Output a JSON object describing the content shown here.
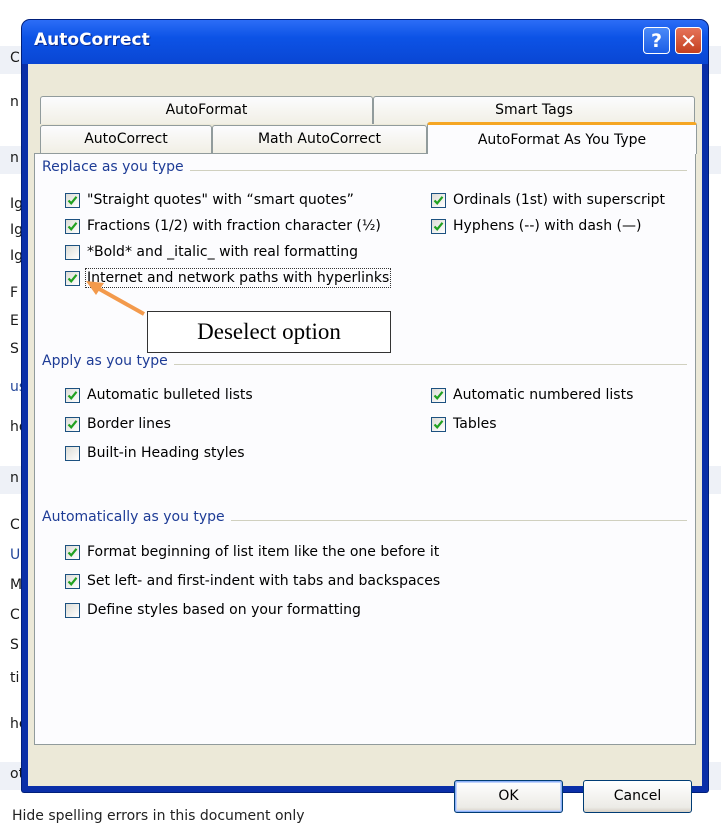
{
  "background": {
    "fragments": [
      "C",
      "n",
      "n",
      "Ig",
      "Ig",
      "Ig",
      "F",
      "E",
      "S",
      "us",
      "hd",
      "n",
      "C",
      "U",
      "M",
      "C",
      "S",
      "ti",
      "he",
      "ot"
    ],
    "bottom_text": "Hide spelling errors in this document only"
  },
  "dialog": {
    "title": "AutoCorrect",
    "help_glyph": "?",
    "close_glyph": "✕",
    "tabs": {
      "autoformat": "AutoFormat",
      "smart_tags": "Smart Tags",
      "autocorrect": "AutoCorrect",
      "math_autocorrect": "Math AutoCorrect",
      "autoformat_as_you_type": "AutoFormat As You Type"
    },
    "groups": {
      "replace": {
        "title": "Replace as you type",
        "options": [
          {
            "label": "\"Straight quotes\" with “smart quotes”",
            "checked": true
          },
          {
            "label": "Ordinals (1st) with superscript",
            "checked": true
          },
          {
            "label": "Fractions (1/2) with fraction character (½)",
            "checked": true
          },
          {
            "label": "Hyphens (--) with dash (—)",
            "checked": true
          },
          {
            "label": "*Bold* and _italic_ with real formatting",
            "checked": false
          },
          {
            "label": "Internet and network paths with hyperlinks",
            "checked": true
          }
        ]
      },
      "apply": {
        "title": "Apply as you type",
        "options": [
          {
            "label": "Automatic bulleted lists",
            "checked": true
          },
          {
            "label": "Automatic numbered lists",
            "checked": true
          },
          {
            "label": "Border lines",
            "checked": true
          },
          {
            "label": "Tables",
            "checked": true
          },
          {
            "label": "Built-in Heading styles",
            "checked": false
          }
        ]
      },
      "auto": {
        "title": "Automatically as you type",
        "options": [
          {
            "label": "Format beginning of list item like the one before it",
            "checked": true
          },
          {
            "label": "Set left- and first-indent with tabs and backspaces",
            "checked": true
          },
          {
            "label": "Define styles based on your formatting",
            "checked": false
          }
        ]
      }
    },
    "callout": "Deselect option",
    "buttons": {
      "ok": "OK",
      "cancel": "Cancel"
    },
    "colors": {
      "title_bar": "#0c53e6",
      "client": "#ece9d8",
      "group_title": "#1e3c96",
      "active_tab_accent": "#f5a623",
      "callout_arrow": "#f39a4c"
    }
  }
}
